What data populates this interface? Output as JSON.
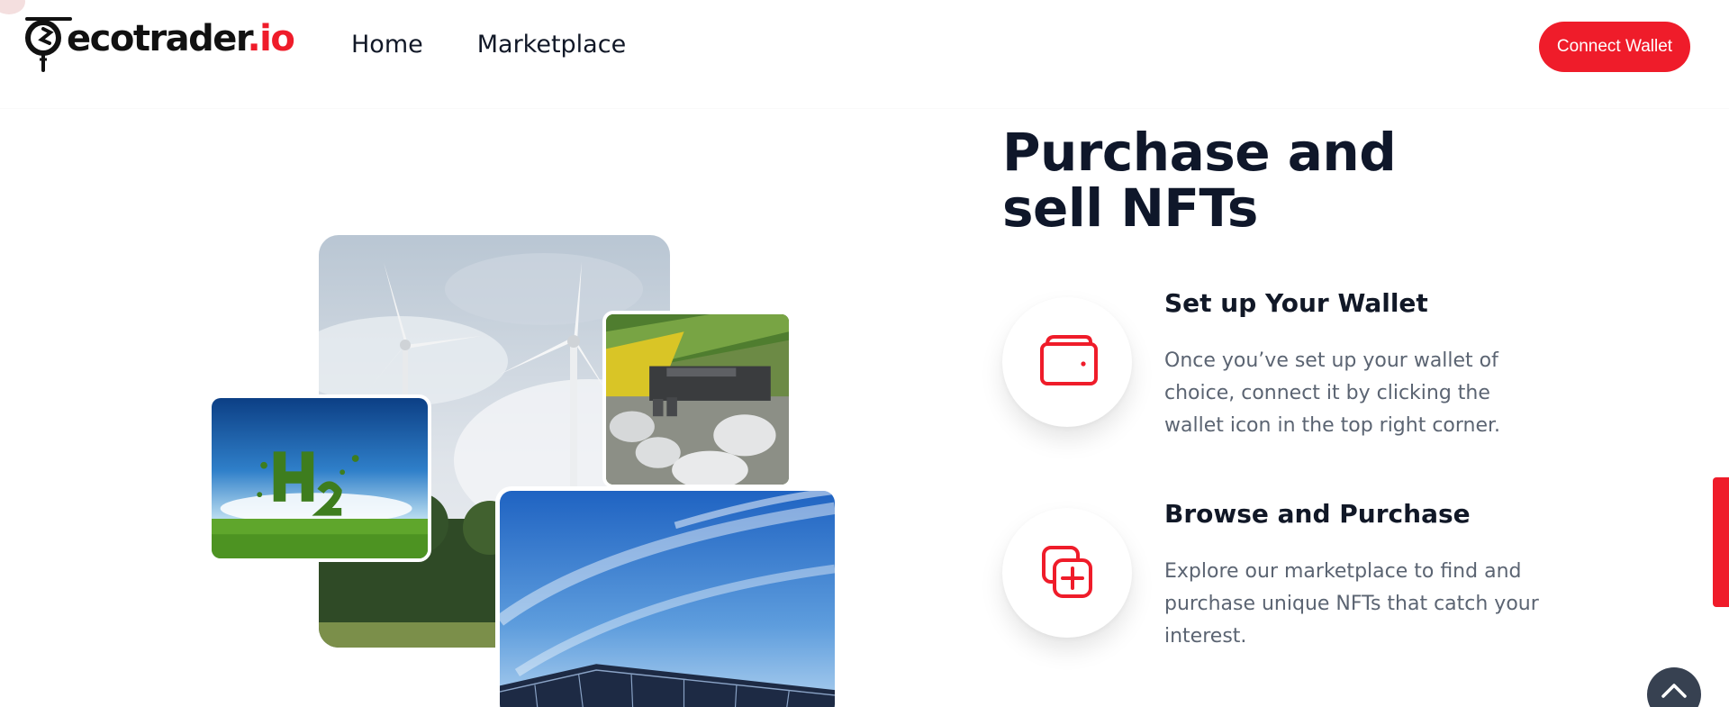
{
  "brand": {
    "name": "ecotrader",
    "tld": ".io",
    "accent_color": "#ef1c2a"
  },
  "nav": {
    "items": [
      {
        "label": "Home"
      },
      {
        "label": "Marketplace"
      }
    ]
  },
  "header": {
    "connect_label": "Connect Wallet"
  },
  "collage": {
    "images": [
      {
        "subject": "wind turbines in cloudy sky"
      },
      {
        "subject": "green hydrogen H2 letters made of leaves over grass"
      },
      {
        "subject": "aerial view of biogas plant near yellow fields"
      },
      {
        "subject": "solar panels under blue sky"
      }
    ]
  },
  "section": {
    "heading": "Purchase and sell NFTs",
    "steps": [
      {
        "title": "Set up Your Wallet",
        "description": "Once you’ve set up your wallet of choice, connect it by clicking the wallet icon in the top right corner.",
        "icon": "wallet-icon"
      },
      {
        "title": "Browse and Purchase",
        "description": "Explore our marketplace to find and purchase unique NFTs that catch your interest.",
        "icon": "add-card-icon"
      }
    ]
  },
  "colors": {
    "heading": "#0f172a",
    "body_text": "#5b6472",
    "scroll_button": "#374151"
  }
}
